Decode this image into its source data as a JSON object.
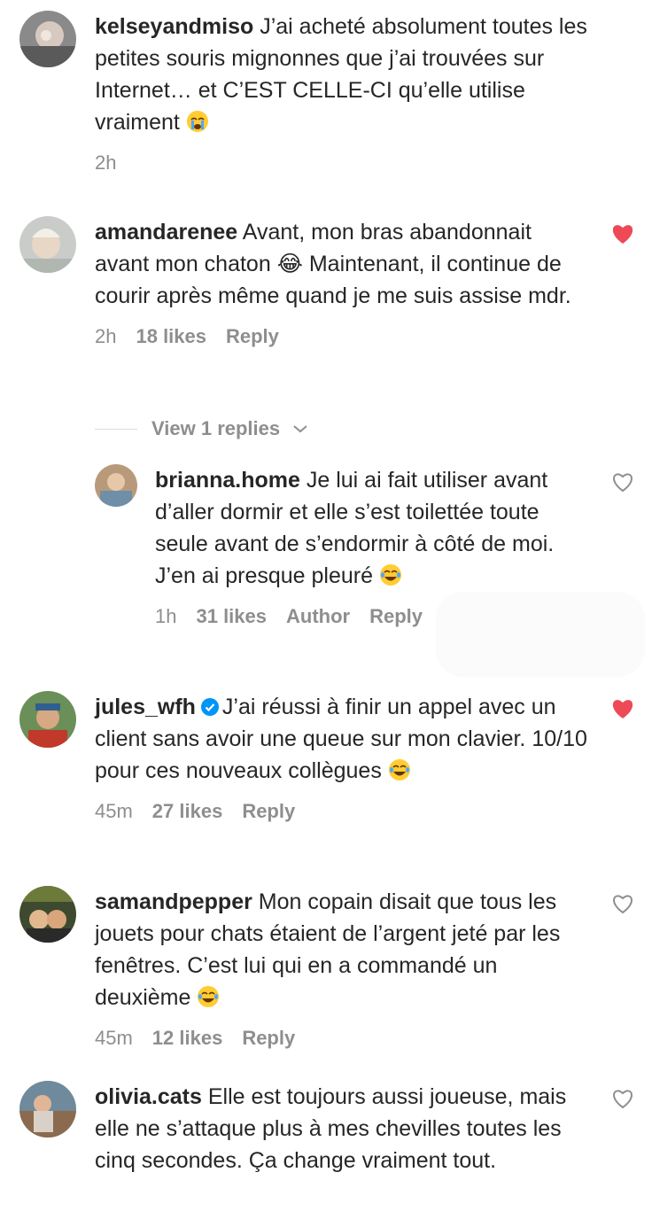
{
  "colors": {
    "text": "#262626",
    "secondary": "#8e8e8e",
    "heart_liked": "#ed4956",
    "verified": "#0095f6"
  },
  "comments": [
    {
      "username": "kelseyandmiso",
      "text": "J’ai acheté absolument toutes les petites souris mignonnes que j’ai trouvées sur Internet… et C’EST CELLE-CI qu’elle utilise vraiment",
      "emoji": "loudly-crying-face",
      "time": "2h",
      "likes": "",
      "reply_label": "",
      "liked": false
    },
    {
      "username": "amandarenee",
      "text": "Avant, mon bras abandonnait avant mon chaton 😂 Maintenant, il continue de courir après même quand je me suis assise mdr.",
      "time": "2h",
      "likes": "18 likes",
      "reply_label": "Reply",
      "liked": true,
      "view_replies": "View 1 replies"
    },
    {
      "username": "brianna.home",
      "text": "Je lui ai fait utiliser avant d’aller dormir et elle s’est toilettée toute seule avant de s’endormir à côté de moi.  J’en ai presque pleuré",
      "emoji": "face-with-tears-of-joy",
      "time": "1h",
      "likes": "31 likes",
      "author_label": "Author",
      "reply_label": "Reply",
      "liked": false
    },
    {
      "username": "jules_wfh",
      "verified": true,
      "text": "J’ai réussi à finir un appel avec un client sans avoir une queue sur mon clavier. 10/10 pour ces nouveaux collègues",
      "emoji": "face-with-tears-of-joy",
      "time": "45m",
      "likes": "27 likes",
      "reply_label": "Reply",
      "liked": true
    },
    {
      "username": "samandpepper",
      "text": "Mon copain disait que tous les jouets pour chats étaient de l’argent jeté par les fenêtres. C’est lui qui en a commandé un deuxième",
      "emoji": "face-with-tears-of-joy",
      "time": "45m",
      "likes": "12 likes",
      "reply_label": "Reply",
      "liked": false
    },
    {
      "username": "olivia.cats",
      "text": "Elle est toujours aussi joueuse, mais elle ne s’attaque plus à mes chevilles toutes les cinq secondes. Ça change vraiment tout.",
      "time": "",
      "likes": "",
      "reply_label": "",
      "liked": false
    }
  ]
}
